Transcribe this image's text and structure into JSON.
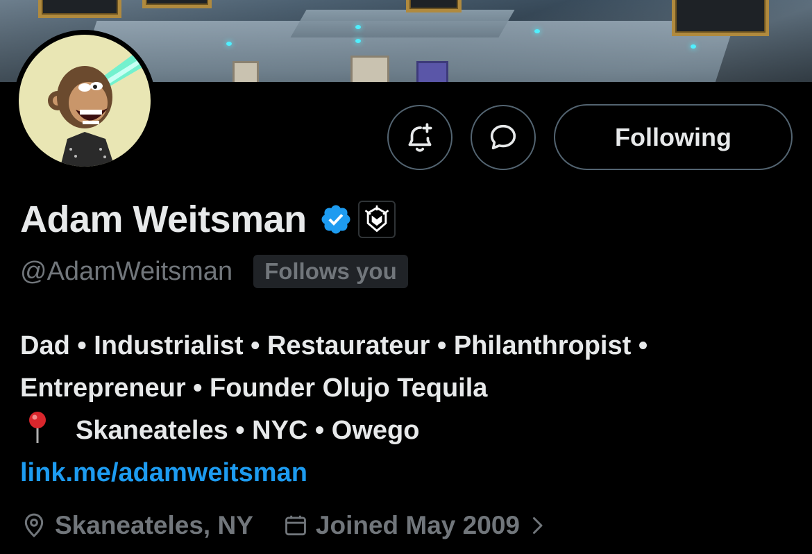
{
  "profile": {
    "name": "Adam Weitsman",
    "handle": "@AdamWeitsman",
    "follows_you": "Follows you",
    "bio_lines": [
      "Dad • Industrialist • Restaurateur • Philanthropist •",
      "Entrepreneur • Founder Olujo Tequila",
      "Skaneateles • NYC • Owego"
    ],
    "link": "link.me/adamweitsman",
    "location": "Skaneateles, NY",
    "joined": "Joined May 2009"
  },
  "actions": {
    "notify_icon": "bell-plus-icon",
    "message_icon": "message-bubble-icon",
    "follow_label": "Following"
  },
  "colors": {
    "background": "#000000",
    "text": "#e7e9ea",
    "muted": "#71767b",
    "accent": "#1d9bf0",
    "verified": "#1d9bf0",
    "border": "#536471"
  }
}
